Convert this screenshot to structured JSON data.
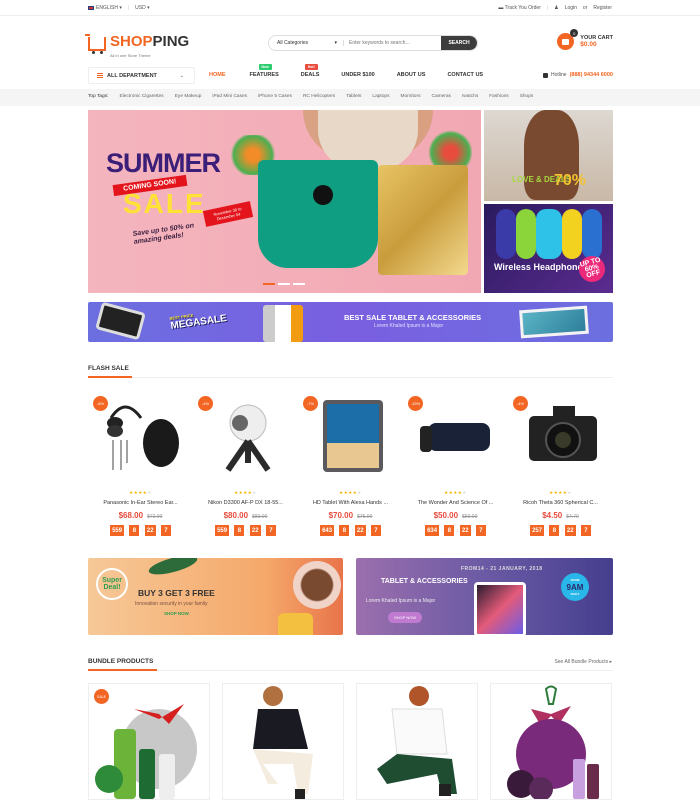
{
  "topbar": {
    "language": "ENGLISH",
    "currency": "USD",
    "track_order": "Track You Order",
    "login": "Login",
    "or": "or",
    "register": "Register"
  },
  "header": {
    "logo_part1": "SHOP",
    "logo_part2": "PING",
    "tagline": "All in one Store Theme",
    "search_category": "All Categories",
    "search_placeholder": "Enter keywords to search...",
    "search_button": "SEARCH",
    "cart_label": "YOUR CART",
    "cart_total": "$0.00",
    "cart_count": "0"
  },
  "nav": {
    "department": "ALL DEPARTMENT",
    "items": [
      {
        "label": "HOME",
        "active": true
      },
      {
        "label": "FEATURES",
        "badge": "New"
      },
      {
        "label": "DEALS",
        "badge": "Hot!"
      },
      {
        "label": "UNDER $100"
      },
      {
        "label": "ABOUT US"
      },
      {
        "label": "CONTACT US"
      }
    ],
    "hotline_label": "Hotline",
    "hotline_number": "(888) 94344 6000"
  },
  "tags": {
    "label": "Top Tags:",
    "items": [
      "Electronic Cigarettes",
      "Eye Makeup",
      "iPad Mini Cases",
      "iPhone 5 Cases",
      "RC Helicopters",
      "Tablets",
      "Laptops",
      "Mornitors",
      "Cameras",
      "Iwatchs",
      "Fashions",
      "Shops"
    ]
  },
  "hero": {
    "summer": "SUMMER",
    "coming": "COMING SOON!",
    "sale": "SALE",
    "save": "Save up to 50% on amazing deals!",
    "date": "November 30 to December 04",
    "slides": 3,
    "active_slide": 1
  },
  "side_banners": {
    "love": "LOVE & DEALS",
    "love_pct": "70%",
    "love_up": "UP TO",
    "love_off": "OFF",
    "wireless": "Wireless Headphones",
    "wireless_pct": "UP TO 60% OFF"
  },
  "wide_banner": {
    "mega_top": "BEST PRICE",
    "mega": "MEGASALE",
    "mega_sub": "UP TO 60% OFF",
    "title": "BEST SALE TABLET &  ACCESSORIES",
    "subtitle": "Lorem Khaled Ipsum is a Major"
  },
  "flash_sale": {
    "title": "FLASH SALE",
    "products": [
      {
        "discount": "-6%",
        "name": "Panasonic In-Ear Stereo Ear...",
        "price": "$68.00",
        "old_price": "$72.00",
        "rating": 4,
        "countdown": [
          "559",
          "8",
          "22",
          "7"
        ]
      },
      {
        "discount": "-4%",
        "name": "Nikon D3300 AF-P DX 18-55...",
        "price": "$80.00",
        "old_price": "$83.00",
        "rating": 4,
        "countdown": [
          "559",
          "8",
          "22",
          "7"
        ]
      },
      {
        "discount": "-7%",
        "name": "HD Tablet With Alexa Hands ...",
        "price": "$70.00",
        "old_price": "$75.00",
        "rating": 4.5,
        "countdown": [
          "643",
          "8",
          "22",
          "7"
        ]
      },
      {
        "discount": "-15%",
        "name": "The Wonder And Science Of ...",
        "price": "$50.00",
        "old_price": "$59.00",
        "rating": 4,
        "countdown": [
          "634",
          "8",
          "22",
          "7"
        ]
      },
      {
        "discount": "-4%",
        "name": "Ricoh Theta 360 Spherical C...",
        "price": "$4.50",
        "old_price": "$4.70",
        "rating": 4,
        "countdown": [
          "257",
          "8",
          "22",
          "7"
        ]
      }
    ]
  },
  "promo_left": {
    "badge": "Super Deal!",
    "title": "BUY 3 GET 3 FREE",
    "subtitle": "Innovation security in your  family",
    "button": "SHOP NOW"
  },
  "promo_right": {
    "from": "FROM14 - 21 JANUARY, 2018",
    "title": "TABLET & ACCESSORIES",
    "subtitle": "Lorem Khaled Ipsum is a Major",
    "button": "SHOP NOW",
    "circle_top": "FROM",
    "circle_main": "9AM",
    "circle_bottom": "DAILY"
  },
  "bundle": {
    "title": "BUNDLE PRODUCTS",
    "see_all": "See All Bundle Products",
    "items": [
      {
        "badge": "SALE",
        "desc": "green gift set"
      },
      {
        "desc": "man in hoodie"
      },
      {
        "desc": "woman in white tee"
      },
      {
        "desc": "purple gift set"
      }
    ]
  },
  "colors": {
    "accent": "#f26522",
    "price": "#e74c3c",
    "dark": "#3d3d3d"
  }
}
